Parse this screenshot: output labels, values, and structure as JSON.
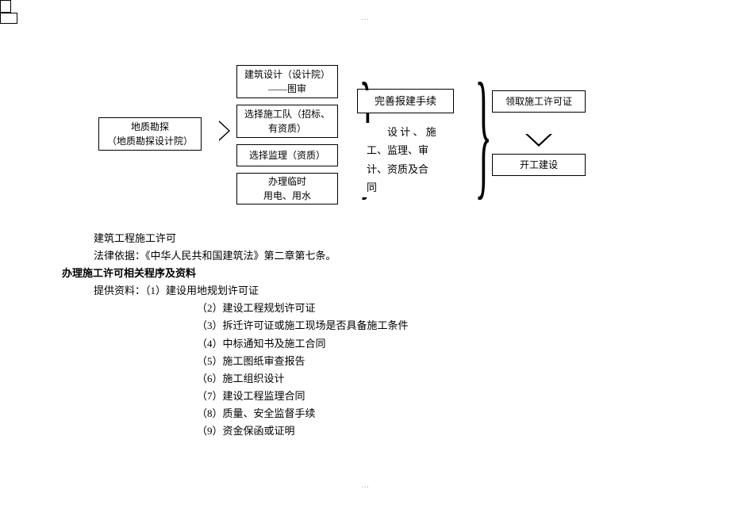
{
  "diagram": {
    "box1_line1": "地质勘探",
    "box1_line2": "（地质勘探设计院）",
    "box2_line1": "建筑设计（设计院）",
    "box2_line2": "——图审",
    "box3_line1": "选择施工队（招标、",
    "box3_line2": "有资质）",
    "box4": "选择监理（资质）",
    "box5_line1": "办理临时",
    "box5_line2": "用电、用水",
    "box6": "完善报建手续",
    "box6_sub1": "　　设 计 、 施",
    "box6_sub2": "工、监理、审",
    "box6_sub3": "计、资质及合",
    "box6_sub4": "同",
    "box7": "领取施工许可证",
    "box8": "开工建设"
  },
  "text": {
    "l1": "建筑工程施工许可",
    "l2": "法律依据：《中华人民共和国建筑法》第二章第七条。",
    "l3_bold": "办理施工许可相关程序及资料",
    "l4_prefix": "提供资料：（1）建设用地规划许可证",
    "items": {
      "i2": "（2）建设工程规划许可证",
      "i3": "（3）拆迁许可证或施工现场是否具备施工条件",
      "i4": "（4）中标通知书及施工合同",
      "i5": "（5）施工图纸审查报告",
      "i6": "（6）施工组织设计",
      "i7": "（7）建设工程监理合同",
      "i8": "（8）质量、安全监督手续",
      "i9": "（9）资金保函或证明"
    }
  }
}
